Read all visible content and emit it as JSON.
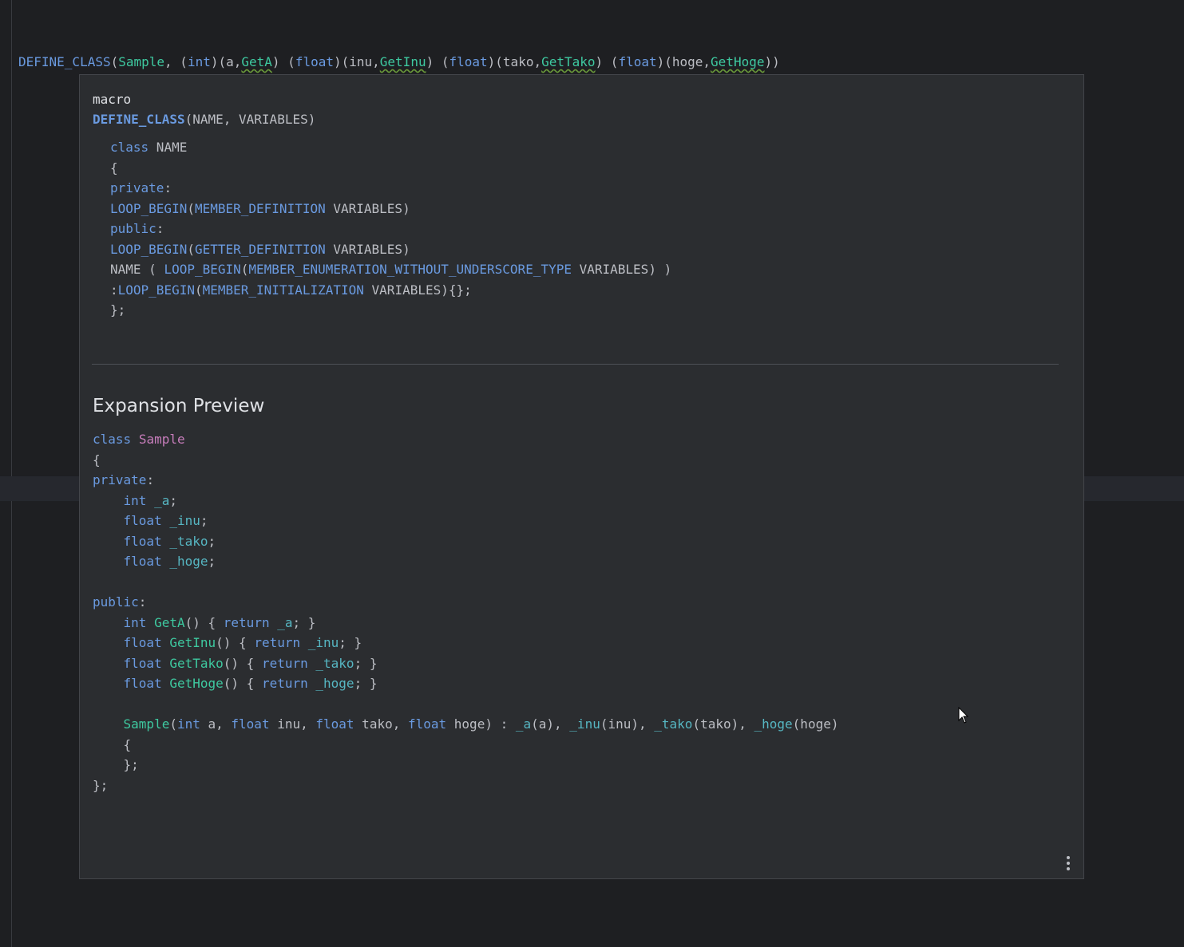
{
  "editor": {
    "line": {
      "macro": "DEFINE_CLASS",
      "open": "(",
      "arg_name": "Sample",
      "sep1": ", (",
      "t1": "int",
      "p1": ")(a,",
      "g1": "GetA",
      "sep2": ") (",
      "t2": "float",
      "p2": ")(inu,",
      "g2": "GetInu",
      "sep3": ") (",
      "t3": "float",
      "p3": ")(tako,",
      "g3": "GetTako",
      "sep4": ") (",
      "t4": "float",
      "p4": ")(hoge,",
      "g4": "GetHoge",
      "close": "))"
    }
  },
  "popup": {
    "kind": "macro",
    "signature_name": "DEFINE_CLASS",
    "signature_params": "(NAME, VARIABLES)",
    "definition": {
      "l1_kw": "class",
      "l1_rest": " NAME",
      "l2": "{",
      "l3_kw": "private",
      "l3_rest": ":",
      "l4_m": "LOOP_BEGIN",
      "l4_p": "(",
      "l4_m2": "MEMBER_DEFINITION",
      "l4_rest": " VARIABLES)",
      "l5_kw": "public",
      "l5_rest": ":",
      "l6_m": "LOOP_BEGIN",
      "l6_p": "(",
      "l6_m2": "GETTER_DEFINITION",
      "l6_rest": " VARIABLES)",
      "l7_a": "NAME ( ",
      "l7_m": "LOOP_BEGIN",
      "l7_p": "(",
      "l7_m2": "MEMBER_ENUMERATION_WITHOUT_UNDERSCORE_TYPE",
      "l7_rest": " VARIABLES) )",
      "l8_a": ":",
      "l8_m": "LOOP_BEGIN",
      "l8_p": "(",
      "l8_m2": "MEMBER_INITIALIZATION",
      "l8_rest": " VARIABLES){};",
      "l9": "};"
    },
    "expansion_title": "Expansion Preview",
    "expansion": {
      "class_kw": "class",
      "class_name": "Sample",
      "open_brace": "{",
      "private_kw": "private",
      "colon": ":",
      "fields": [
        {
          "type": "int",
          "name": "_a"
        },
        {
          "type": "float",
          "name": "_inu"
        },
        {
          "type": "float",
          "name": "_tako"
        },
        {
          "type": "float",
          "name": "_hoge"
        }
      ],
      "public_kw": "public",
      "getters": [
        {
          "type": "int",
          "name": "GetA",
          "ret": "return",
          "field": "_a"
        },
        {
          "type": "float",
          "name": "GetInu",
          "ret": "return",
          "field": "_inu"
        },
        {
          "type": "float",
          "name": "GetTako",
          "ret": "return",
          "field": "_tako"
        },
        {
          "type": "float",
          "name": "GetHoge",
          "ret": "return",
          "field": "_hoge"
        }
      ],
      "ctor_name": "Sample",
      "ctor_t1": "int",
      "ctor_a1": " a, ",
      "ctor_t2": "float",
      "ctor_a2": " inu, ",
      "ctor_t3": "float",
      "ctor_a3": " tako, ",
      "ctor_t4": "float",
      "ctor_a4": " hoge) : ",
      "init": [
        {
          "f": "_a",
          "v": "(a)"
        },
        {
          "f": "_inu",
          "v": "(inu)"
        },
        {
          "f": "_tako",
          "v": "(tako)"
        },
        {
          "f": "_hoge",
          "v": "(hoge)"
        }
      ],
      "ctor_open": "{",
      "ctor_close": "};",
      "close_brace": "};"
    }
  }
}
